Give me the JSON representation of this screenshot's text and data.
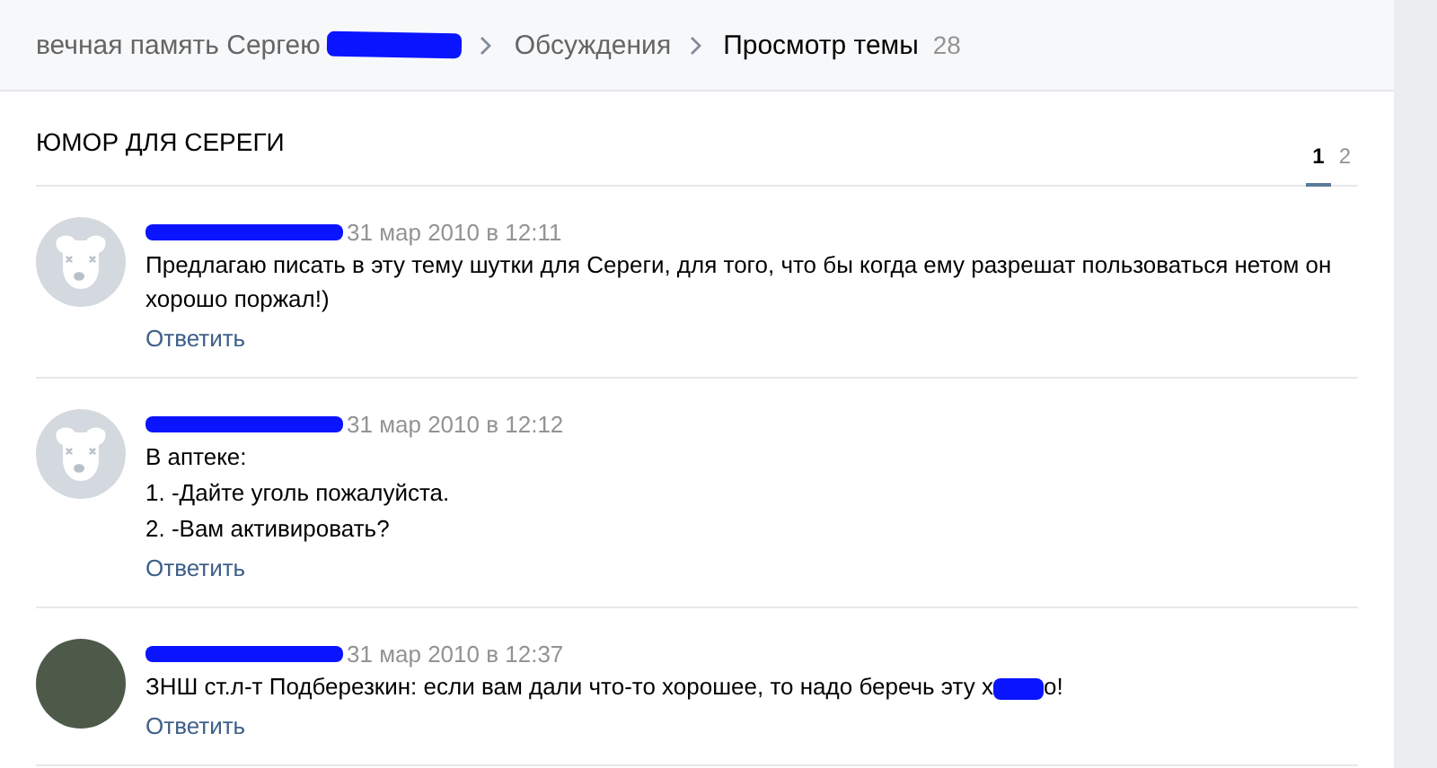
{
  "breadcrumbs": [
    {
      "label": "вечная память Сергею",
      "redacted": true,
      "current": false
    },
    {
      "label": "Обсуждения",
      "redacted": false,
      "current": false
    },
    {
      "label": "Просмотр темы",
      "redacted": false,
      "current": true,
      "count": "28"
    }
  ],
  "topic": {
    "title": "ЮМОР ДЛЯ СЕРЕГИ"
  },
  "pagination": [
    {
      "label": "1",
      "selected": true
    },
    {
      "label": "2",
      "selected": false
    }
  ],
  "posts": [
    {
      "kind": "default-avatar",
      "author_redacted": true,
      "date": "31 мар 2010 в 12:11",
      "lines": [
        {
          "parts": [
            {
              "kind": "text",
              "text": "Предлагаю писать в эту тему шутки для Сереги, для того, что бы когда ему разрешат пользоваться нетом он хорошо поржал!)"
            }
          ]
        }
      ],
      "reply": "Ответить"
    },
    {
      "kind": "default-avatar",
      "author_redacted": true,
      "date": "31 мар 2010 в 12:12",
      "lines": [
        {
          "parts": [
            {
              "kind": "text",
              "text": "В аптеке:"
            }
          ]
        },
        {
          "parts": [
            {
              "kind": "text",
              "text": "1. -Дайте уголь пожалуйста."
            }
          ]
        },
        {
          "parts": [
            {
              "kind": "text",
              "text": "2. -Вам активировать?"
            }
          ]
        }
      ],
      "reply": "Ответить"
    },
    {
      "kind": "photo-avatar",
      "author_redacted": true,
      "date": "31 мар 2010 в 12:37",
      "lines": [
        {
          "parts": [
            {
              "kind": "text",
              "text": "ЗНШ ст.л-т Подберезкин: если вам дали что-то хорошее, то надо беречь эту х"
            },
            {
              "kind": "redaction"
            },
            {
              "kind": "text",
              "text": "о!"
            }
          ]
        }
      ],
      "reply": "Ответить"
    }
  ]
}
